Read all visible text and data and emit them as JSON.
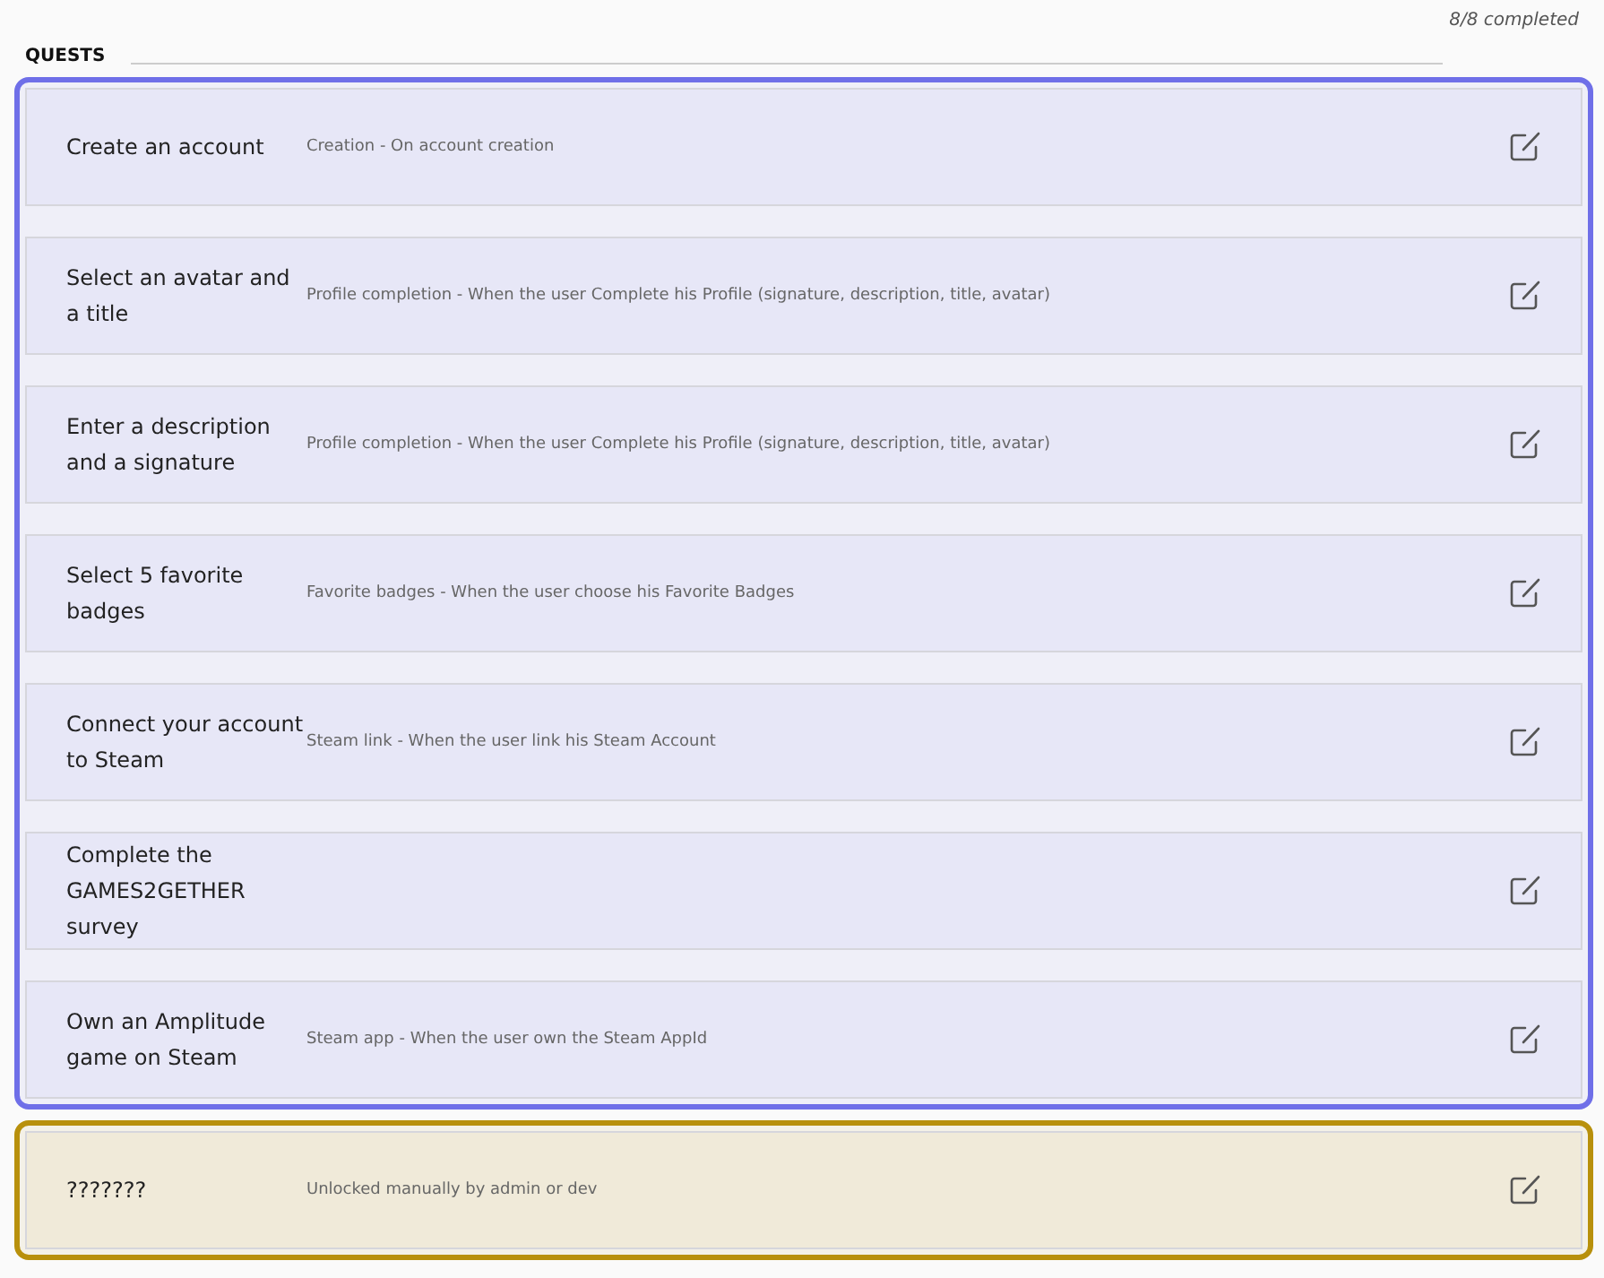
{
  "progress": "8/8 completed",
  "section_title": "QUESTS",
  "groups": [
    {
      "color": "#6f6fe8",
      "quests": [
        {
          "title": "Create an account",
          "description": "Creation - On account creation"
        },
        {
          "title": "Select an avatar and a title",
          "description": "Profile completion - When the user Complete his Profile (signature, description, title, avatar)"
        },
        {
          "title": "Enter a description and a signature",
          "description": "Profile completion - When the user Complete his Profile (signature, description, title, avatar)"
        },
        {
          "title": "Select 5 favorite badges",
          "description": "Favorite badges - When the user choose his Favorite Badges"
        },
        {
          "title": "Connect your account to Steam",
          "description": "Steam link - When the user link his Steam Account"
        },
        {
          "title": "Complete the GAMES2GETHER survey"
        },
        {
          "title": "Own an Amplitude game on Steam",
          "description": "Steam app - When the user own the Steam AppId"
        }
      ]
    },
    {
      "color": "#b8900c",
      "quests": [
        {
          "title": "???????",
          "description": "Unlocked manually by admin or dev"
        }
      ]
    }
  ]
}
